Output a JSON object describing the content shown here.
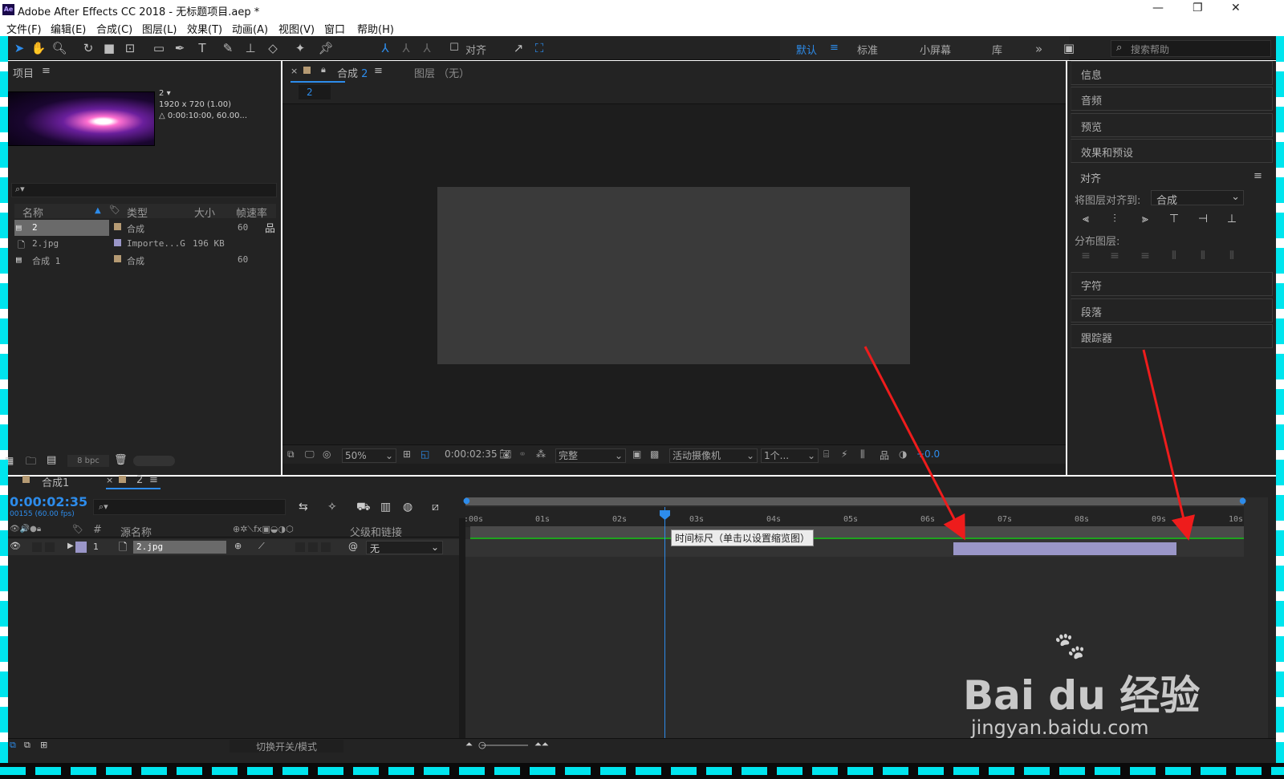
{
  "window": {
    "title": "Adobe After Effects CC 2018 - 无标题项目.aep *",
    "logo": "Ae"
  },
  "menu": [
    "文件(F)",
    "编辑(E)",
    "合成(C)",
    "图层(L)",
    "效果(T)",
    "动画(A)",
    "视图(V)",
    "窗口",
    "帮助(H)"
  ],
  "toolbar": {
    "align_label": "对齐",
    "workspaces": [
      "默认",
      "标准",
      "小屏幕",
      "库"
    ],
    "active_workspace": "默认",
    "search_placeholder": "搜索帮助"
  },
  "project": {
    "panel_title": "项目",
    "selected_name": "2",
    "selected_info": [
      "1920 x 720 (1.00)",
      "△ 0:00:10:00, 60.00..."
    ],
    "columns": [
      "名称",
      "类型",
      "大小",
      "帧速率"
    ],
    "items": [
      {
        "name": "2",
        "type": "合成",
        "size": "",
        "fps": "60",
        "color": "#b59a73"
      },
      {
        "name": "2.jpg",
        "type": "Importe...G",
        "size": "196 KB",
        "fps": "",
        "color": "#9a96c8"
      },
      {
        "name": "合成 1",
        "type": "合成",
        "size": "",
        "fps": "60",
        "color": "#b59a73"
      }
    ],
    "bpc": "8 bpc"
  },
  "viewer": {
    "tab_label": "合成",
    "tab_num": "2",
    "layer_tab": "图层 （无）",
    "crumb": "2",
    "zoom": "50%",
    "timecode": "0:00:02:35",
    "quality": "完整",
    "camera": "活动摄像机",
    "views": "1个...",
    "exposure": "+0.0"
  },
  "right_panels": {
    "top": [
      "信息",
      "音频",
      "预览",
      "效果和预设"
    ],
    "align_title": "对齐",
    "align_to_label": "将图层对齐到:",
    "align_to_value": "合成",
    "distribute_label": "分布图层:",
    "bottom": [
      "字符",
      "段落",
      "跟踪器"
    ]
  },
  "timeline": {
    "tabs": [
      "合成1",
      "2"
    ],
    "timecode": "0:00:02:35",
    "fps_info": "00155 (60.00 fps)",
    "columns": {
      "source_name": "源名称",
      "parent": "父级和链接"
    },
    "layer": {
      "num": "1",
      "name": "2.jpg",
      "parent": "无",
      "color": "#9a96c8"
    },
    "ruler": [
      ":00s",
      "01s",
      "02s",
      "03s",
      "04s",
      "05s",
      "06s",
      "07s",
      "08s",
      "09s",
      "10s"
    ],
    "tooltip": "时间标尺（单击以设置缩览图）",
    "footer_toggle": "切换开关/模式"
  },
  "watermark": {
    "brand": "Bai du 经验",
    "url": "jingyan.baidu.com"
  },
  "colors": {
    "accent": "#2d8ceb",
    "frame": "#00e5ee",
    "arrow": "#ee1c1c"
  }
}
